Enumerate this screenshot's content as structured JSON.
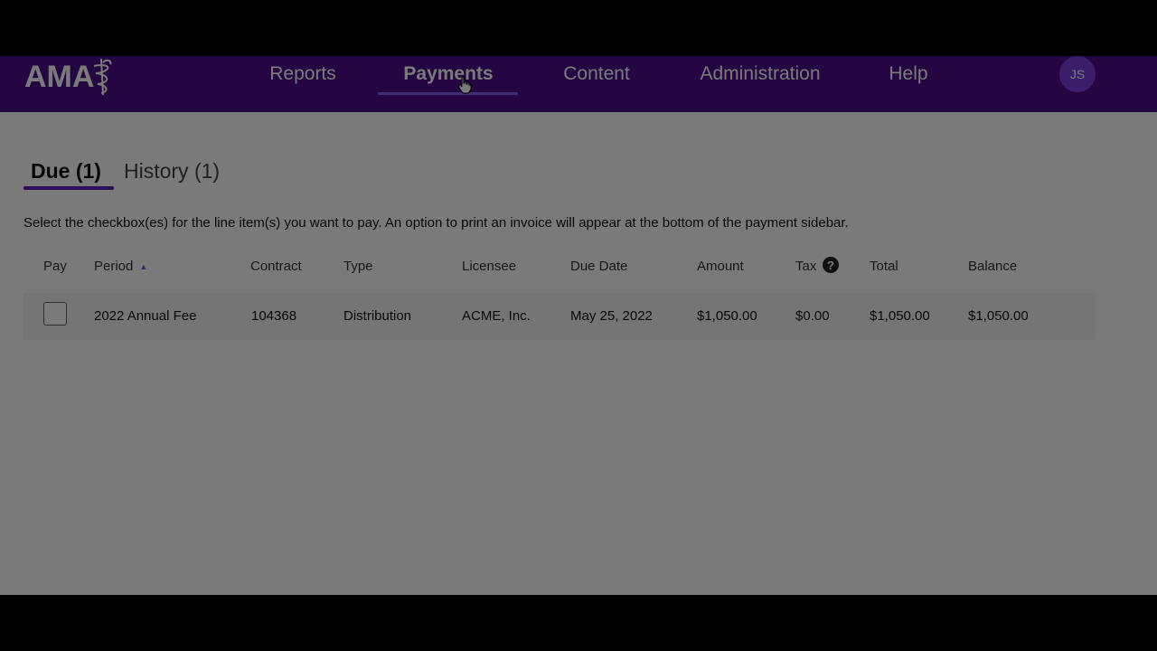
{
  "nav": {
    "logo_text": "AMA",
    "items": [
      {
        "label": "Reports"
      },
      {
        "label": "Payments"
      },
      {
        "label": "Content"
      },
      {
        "label": "Administration"
      },
      {
        "label": "Help"
      }
    ],
    "active": "Payments",
    "avatar_initials": "JS"
  },
  "tabs": [
    {
      "label": "Due (1)"
    },
    {
      "label": "History (1)"
    }
  ],
  "instructions": "Select the checkbox(es) for the line item(s) you want to pay.  An option to print an invoice will appear at the bottom of the payment sidebar.",
  "table": {
    "columns": [
      "Pay",
      "Period",
      "Contract",
      "Type",
      "Licensee",
      "Due Date",
      "Amount",
      "Tax",
      "Total",
      "Balance"
    ],
    "sorted_column": "Period",
    "sort_direction": "ascending",
    "rows": [
      {
        "pay_checked": false,
        "period": "2022 Annual Fee",
        "contract": "104368",
        "type": "Distribution",
        "licensee": "ACME, Inc.",
        "due_date": "May 25, 2022",
        "amount": "$1,050.00",
        "tax": "$0.00",
        "total": "$1,050.00",
        "balance": "$1,050.00"
      }
    ]
  },
  "colors": {
    "nav_background": "#4b0f8a",
    "accent": "#8a5cf0",
    "tab_underline": "#5a1fb0",
    "avatar": "#7a3fe0"
  },
  "icons": {
    "logo": "ama-caduceus-logo",
    "sort": "sort-ascending-icon",
    "tax_help": "question-circle-icon",
    "cursor": "hand-pointer-cursor"
  }
}
